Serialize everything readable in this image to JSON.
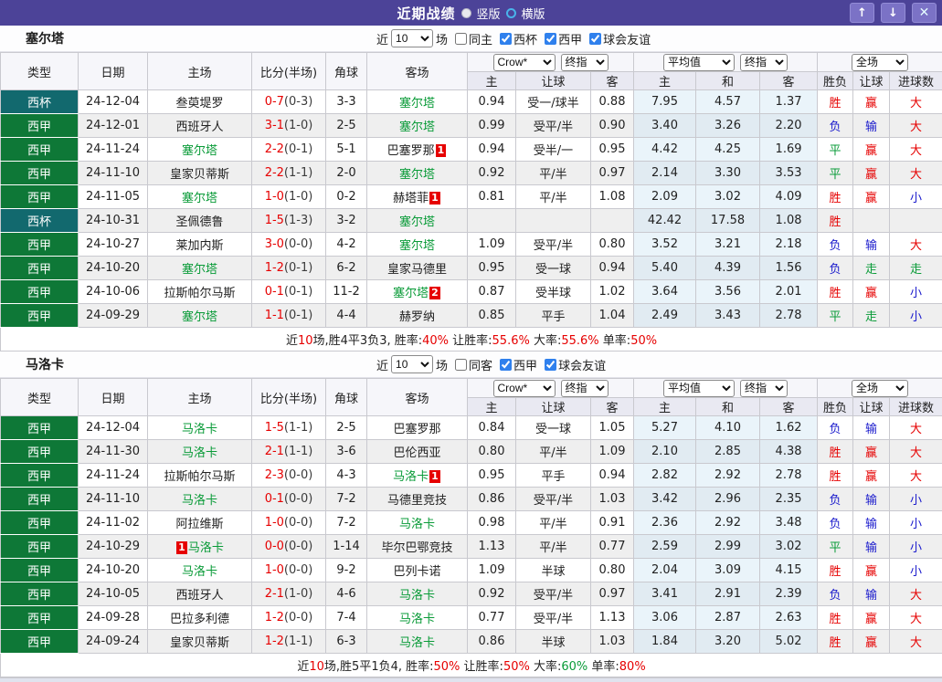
{
  "titlebar": {
    "title": "近期战绩",
    "radios": [
      {
        "label": "竖版",
        "selected": true
      },
      {
        "label": "横版",
        "selected": false
      }
    ],
    "buttons": {
      "up": "↑",
      "down": "↓",
      "close": "✕"
    }
  },
  "filter_labels": {
    "near": "近",
    "count": "10",
    "matches": "场"
  },
  "selector_groups": [
    [
      "Crow*",
      "终指"
    ],
    [
      "平均值",
      "终指"
    ],
    [
      "全场"
    ]
  ],
  "columns": [
    "类型",
    "日期",
    "主场",
    "比分(半场)",
    "角球",
    "客场",
    "主",
    "让球",
    "客",
    "主",
    "和",
    "客",
    "胜负",
    "让球",
    "进球数"
  ],
  "type_colors": {
    "西杯": "#12696e",
    "西甲": "#0e7837"
  },
  "result_colors": {
    "r": "#e60000",
    "b": "#1a1acc",
    "g": "#0a9b38",
    "k": "#222222"
  },
  "sections": [
    {
      "team": "塞尔塔",
      "same_label": "同主",
      "same_checked": false,
      "leagues": [
        {
          "label": "西杯",
          "checked": true
        },
        {
          "label": "西甲",
          "checked": true
        },
        {
          "label": "球会友谊",
          "checked": true
        }
      ],
      "rows": [
        {
          "type": "西杯",
          "date": "24-12-04",
          "home": "叁萸堤罗",
          "home_focus": false,
          "home_badge": "",
          "home_badge_pre": false,
          "score": "0-7",
          "half": "(0-3)",
          "corners": "3-3",
          "away": "塞尔塔",
          "away_focus": true,
          "away_badge": "",
          "odds": [
            "0.94",
            "受一/球半",
            "0.88"
          ],
          "avg": [
            "7.95",
            "4.57",
            "1.37"
          ],
          "results": [
            [
              "胜",
              "r"
            ],
            [
              "赢",
              "r"
            ],
            [
              "大",
              "r"
            ]
          ]
        },
        {
          "type": "西甲",
          "date": "24-12-01",
          "home": "西班牙人",
          "home_focus": false,
          "home_badge": "",
          "home_badge_pre": false,
          "score": "3-1",
          "half": "(1-0)",
          "corners": "2-5",
          "away": "塞尔塔",
          "away_focus": true,
          "away_badge": "",
          "odds": [
            "0.99",
            "受平/半",
            "0.90"
          ],
          "avg": [
            "3.40",
            "3.26",
            "2.20"
          ],
          "results": [
            [
              "负",
              "b"
            ],
            [
              "输",
              "b"
            ],
            [
              "大",
              "r"
            ]
          ]
        },
        {
          "type": "西甲",
          "date": "24-11-24",
          "home": "塞尔塔",
          "home_focus": true,
          "home_badge": "",
          "home_badge_pre": false,
          "score": "2-2",
          "half": "(0-1)",
          "corners": "5-1",
          "away": "巴塞罗那",
          "away_focus": false,
          "away_badge": "1",
          "odds": [
            "0.94",
            "受半/一",
            "0.95"
          ],
          "avg": [
            "4.42",
            "4.25",
            "1.69"
          ],
          "results": [
            [
              "平",
              "g"
            ],
            [
              "赢",
              "r"
            ],
            [
              "大",
              "r"
            ]
          ]
        },
        {
          "type": "西甲",
          "date": "24-11-10",
          "home": "皇家贝蒂斯",
          "home_focus": false,
          "home_badge": "",
          "home_badge_pre": false,
          "score": "2-2",
          "half": "(1-1)",
          "corners": "2-0",
          "away": "塞尔塔",
          "away_focus": true,
          "away_badge": "",
          "odds": [
            "0.92",
            "平/半",
            "0.97"
          ],
          "avg": [
            "2.14",
            "3.30",
            "3.53"
          ],
          "results": [
            [
              "平",
              "g"
            ],
            [
              "赢",
              "r"
            ],
            [
              "大",
              "r"
            ]
          ]
        },
        {
          "type": "西甲",
          "date": "24-11-05",
          "home": "塞尔塔",
          "home_focus": true,
          "home_badge": "",
          "home_badge_pre": false,
          "score": "1-0",
          "half": "(1-0)",
          "corners": "0-2",
          "away": "赫塔菲",
          "away_focus": false,
          "away_badge": "1",
          "odds": [
            "0.81",
            "平/半",
            "1.08"
          ],
          "avg": [
            "2.09",
            "3.02",
            "4.09"
          ],
          "results": [
            [
              "胜",
              "r"
            ],
            [
              "赢",
              "r"
            ],
            [
              "小",
              "b"
            ]
          ]
        },
        {
          "type": "西杯",
          "date": "24-10-31",
          "home": "圣佩德鲁",
          "home_focus": false,
          "home_badge": "",
          "home_badge_pre": false,
          "score": "1-5",
          "half": "(1-3)",
          "corners": "3-2",
          "away": "塞尔塔",
          "away_focus": true,
          "away_badge": "",
          "odds": [
            "",
            "",
            ""
          ],
          "avg": [
            "42.42",
            "17.58",
            "1.08"
          ],
          "results": [
            [
              "胜",
              "r"
            ],
            [
              "",
              "k"
            ],
            [
              "",
              "k"
            ]
          ]
        },
        {
          "type": "西甲",
          "date": "24-10-27",
          "home": "莱加内斯",
          "home_focus": false,
          "home_badge": "",
          "home_badge_pre": false,
          "score": "3-0",
          "half": "(0-0)",
          "corners": "4-2",
          "away": "塞尔塔",
          "away_focus": true,
          "away_badge": "",
          "odds": [
            "1.09",
            "受平/半",
            "0.80"
          ],
          "avg": [
            "3.52",
            "3.21",
            "2.18"
          ],
          "results": [
            [
              "负",
              "b"
            ],
            [
              "输",
              "b"
            ],
            [
              "大",
              "r"
            ]
          ]
        },
        {
          "type": "西甲",
          "date": "24-10-20",
          "home": "塞尔塔",
          "home_focus": true,
          "home_badge": "",
          "home_badge_pre": false,
          "score": "1-2",
          "half": "(0-1)",
          "corners": "6-2",
          "away": "皇家马德里",
          "away_focus": false,
          "away_badge": "",
          "odds": [
            "0.95",
            "受一球",
            "0.94"
          ],
          "avg": [
            "5.40",
            "4.39",
            "1.56"
          ],
          "results": [
            [
              "负",
              "b"
            ],
            [
              "走",
              "g"
            ],
            [
              "走",
              "g"
            ]
          ]
        },
        {
          "type": "西甲",
          "date": "24-10-06",
          "home": "拉斯帕尔马斯",
          "home_focus": false,
          "home_badge": "",
          "home_badge_pre": false,
          "score": "0-1",
          "half": "(0-1)",
          "corners": "11-2",
          "away": "塞尔塔",
          "away_focus": true,
          "away_badge": "2",
          "odds": [
            "0.87",
            "受半球",
            "1.02"
          ],
          "avg": [
            "3.64",
            "3.56",
            "2.01"
          ],
          "results": [
            [
              "胜",
              "r"
            ],
            [
              "赢",
              "r"
            ],
            [
              "小",
              "b"
            ]
          ]
        },
        {
          "type": "西甲",
          "date": "24-09-29",
          "home": "塞尔塔",
          "home_focus": true,
          "home_badge": "",
          "home_badge_pre": false,
          "score": "1-1",
          "half": "(0-1)",
          "corners": "4-4",
          "away": "赫罗纳",
          "away_focus": false,
          "away_badge": "",
          "odds": [
            "0.85",
            "平手",
            "1.04"
          ],
          "avg": [
            "2.49",
            "3.43",
            "2.78"
          ],
          "results": [
            [
              "平",
              "g"
            ],
            [
              "走",
              "g"
            ],
            [
              "小",
              "b"
            ]
          ]
        }
      ],
      "summary": [
        [
          "近",
          "k"
        ],
        [
          "10",
          "r"
        ],
        [
          "场,胜4平3负3, 胜率:",
          "k"
        ],
        [
          "40%",
          "r"
        ],
        [
          " 让胜率:",
          "k"
        ],
        [
          "55.6%",
          "r"
        ],
        [
          " 大率:",
          "k"
        ],
        [
          "55.6%",
          "r"
        ],
        [
          " 单率:",
          "k"
        ],
        [
          "50%",
          "r"
        ]
      ]
    },
    {
      "team": "马洛卡",
      "same_label": "同客",
      "same_checked": false,
      "leagues": [
        {
          "label": "西甲",
          "checked": true
        },
        {
          "label": "球会友谊",
          "checked": true
        }
      ],
      "rows": [
        {
          "type": "西甲",
          "date": "24-12-04",
          "home": "马洛卡",
          "home_focus": true,
          "home_badge": "",
          "home_badge_pre": false,
          "score": "1-5",
          "half": "(1-1)",
          "corners": "2-5",
          "away": "巴塞罗那",
          "away_focus": false,
          "away_badge": "",
          "odds": [
            "0.84",
            "受一球",
            "1.05"
          ],
          "avg": [
            "5.27",
            "4.10",
            "1.62"
          ],
          "results": [
            [
              "负",
              "b"
            ],
            [
              "输",
              "b"
            ],
            [
              "大",
              "r"
            ]
          ]
        },
        {
          "type": "西甲",
          "date": "24-11-30",
          "home": "马洛卡",
          "home_focus": true,
          "home_badge": "",
          "home_badge_pre": false,
          "score": "2-1",
          "half": "(1-1)",
          "corners": "3-6",
          "away": "巴伦西亚",
          "away_focus": false,
          "away_badge": "",
          "odds": [
            "0.80",
            "平/半",
            "1.09"
          ],
          "avg": [
            "2.10",
            "2.85",
            "4.38"
          ],
          "results": [
            [
              "胜",
              "r"
            ],
            [
              "赢",
              "r"
            ],
            [
              "大",
              "r"
            ]
          ]
        },
        {
          "type": "西甲",
          "date": "24-11-24",
          "home": "拉斯帕尔马斯",
          "home_focus": false,
          "home_badge": "",
          "home_badge_pre": false,
          "score": "2-3",
          "half": "(0-0)",
          "corners": "4-3",
          "away": "马洛卡",
          "away_focus": true,
          "away_badge": "1",
          "odds": [
            "0.95",
            "平手",
            "0.94"
          ],
          "avg": [
            "2.82",
            "2.92",
            "2.78"
          ],
          "results": [
            [
              "胜",
              "r"
            ],
            [
              "赢",
              "r"
            ],
            [
              "大",
              "r"
            ]
          ]
        },
        {
          "type": "西甲",
          "date": "24-11-10",
          "home": "马洛卡",
          "home_focus": true,
          "home_badge": "",
          "home_badge_pre": false,
          "score": "0-1",
          "half": "(0-0)",
          "corners": "7-2",
          "away": "马德里竞技",
          "away_focus": false,
          "away_badge": "",
          "odds": [
            "0.86",
            "受平/半",
            "1.03"
          ],
          "avg": [
            "3.42",
            "2.96",
            "2.35"
          ],
          "results": [
            [
              "负",
              "b"
            ],
            [
              "输",
              "b"
            ],
            [
              "小",
              "b"
            ]
          ]
        },
        {
          "type": "西甲",
          "date": "24-11-02",
          "home": "阿拉维斯",
          "home_focus": false,
          "home_badge": "",
          "home_badge_pre": false,
          "score": "1-0",
          "half": "(0-0)",
          "corners": "7-2",
          "away": "马洛卡",
          "away_focus": true,
          "away_badge": "",
          "odds": [
            "0.98",
            "平/半",
            "0.91"
          ],
          "avg": [
            "2.36",
            "2.92",
            "3.48"
          ],
          "results": [
            [
              "负",
              "b"
            ],
            [
              "输",
              "b"
            ],
            [
              "小",
              "b"
            ]
          ]
        },
        {
          "type": "西甲",
          "date": "24-10-29",
          "home": "马洛卡",
          "home_focus": true,
          "home_badge": "1",
          "home_badge_pre": true,
          "score": "0-0",
          "half": "(0-0)",
          "corners": "1-14",
          "away": "毕尔巴鄂竞技",
          "away_focus": false,
          "away_badge": "",
          "odds": [
            "1.13",
            "平/半",
            "0.77"
          ],
          "avg": [
            "2.59",
            "2.99",
            "3.02"
          ],
          "results": [
            [
              "平",
              "g"
            ],
            [
              "输",
              "b"
            ],
            [
              "小",
              "b"
            ]
          ]
        },
        {
          "type": "西甲",
          "date": "24-10-20",
          "home": "马洛卡",
          "home_focus": true,
          "home_badge": "",
          "home_badge_pre": false,
          "score": "1-0",
          "half": "(0-0)",
          "corners": "9-2",
          "away": "巴列卡诺",
          "away_focus": false,
          "away_badge": "",
          "odds": [
            "1.09",
            "半球",
            "0.80"
          ],
          "avg": [
            "2.04",
            "3.09",
            "4.15"
          ],
          "results": [
            [
              "胜",
              "r"
            ],
            [
              "赢",
              "r"
            ],
            [
              "小",
              "b"
            ]
          ]
        },
        {
          "type": "西甲",
          "date": "24-10-05",
          "home": "西班牙人",
          "home_focus": false,
          "home_badge": "",
          "home_badge_pre": false,
          "score": "2-1",
          "half": "(1-0)",
          "corners": "4-6",
          "away": "马洛卡",
          "away_focus": true,
          "away_badge": "",
          "odds": [
            "0.92",
            "受平/半",
            "0.97"
          ],
          "avg": [
            "3.41",
            "2.91",
            "2.39"
          ],
          "results": [
            [
              "负",
              "b"
            ],
            [
              "输",
              "b"
            ],
            [
              "大",
              "r"
            ]
          ]
        },
        {
          "type": "西甲",
          "date": "24-09-28",
          "home": "巴拉多利德",
          "home_focus": false,
          "home_badge": "",
          "home_badge_pre": false,
          "score": "1-2",
          "half": "(0-0)",
          "corners": "7-4",
          "away": "马洛卡",
          "away_focus": true,
          "away_badge": "",
          "odds": [
            "0.77",
            "受平/半",
            "1.13"
          ],
          "avg": [
            "3.06",
            "2.87",
            "2.63"
          ],
          "results": [
            [
              "胜",
              "r"
            ],
            [
              "赢",
              "r"
            ],
            [
              "大",
              "r"
            ]
          ]
        },
        {
          "type": "西甲",
          "date": "24-09-24",
          "home": "皇家贝蒂斯",
          "home_focus": false,
          "home_badge": "",
          "home_badge_pre": false,
          "score": "1-2",
          "half": "(1-1)",
          "corners": "6-3",
          "away": "马洛卡",
          "away_focus": true,
          "away_badge": "",
          "odds": [
            "0.86",
            "半球",
            "1.03"
          ],
          "avg": [
            "1.84",
            "3.20",
            "5.02"
          ],
          "results": [
            [
              "胜",
              "r"
            ],
            [
              "赢",
              "r"
            ],
            [
              "大",
              "r"
            ]
          ]
        }
      ],
      "summary": [
        [
          "近",
          "k"
        ],
        [
          "10",
          "r"
        ],
        [
          "场,胜5平1负4, 胜率:",
          "k"
        ],
        [
          "50%",
          "r"
        ],
        [
          " 让胜率:",
          "k"
        ],
        [
          "50%",
          "r"
        ],
        [
          " 大率:",
          "k"
        ],
        [
          "60%",
          "g"
        ],
        [
          " 单率:",
          "k"
        ],
        [
          "80%",
          "r"
        ]
      ]
    }
  ]
}
